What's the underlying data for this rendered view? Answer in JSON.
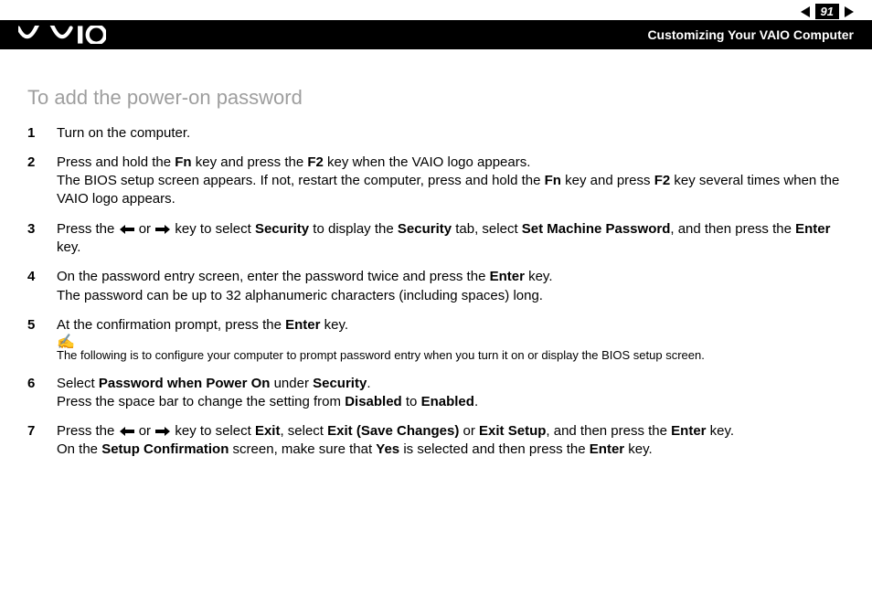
{
  "header": {
    "pageNumber": "91",
    "sectionTitle": "Customizing Your VAIO Computer"
  },
  "heading": "To add the power-on password",
  "steps": {
    "s1": "Turn on the computer.",
    "s2a": "Press and hold the ",
    "s2b": " key and press the ",
    "s2c": " key when the VAIO logo appears.",
    "s2d": "The BIOS setup screen appears. If not, restart the computer, press and hold the ",
    "s2e": " key and press ",
    "s2f": " key several times when the VAIO logo appears.",
    "s3a": "Press the ",
    "s3b": " or ",
    "s3c": " key to select ",
    "s3d": " to display the ",
    "s3e": " tab, select ",
    "s3f": ", and then press the ",
    "s3g": " key.",
    "s4a": "On the password entry screen, enter the password twice and press the ",
    "s4b": " key.",
    "s4c": "The password can be up to 32 alphanumeric characters (including spaces) long.",
    "s5a": "At the confirmation prompt, press the ",
    "s5b": " key.",
    "s6a": "Select ",
    "s6b": " under ",
    "s6c": ".",
    "s6d": "Press the space bar to change the setting from ",
    "s6e": " to ",
    "s6f": ".",
    "s7a": "Press the ",
    "s7b": " or ",
    "s7c": " key to select ",
    "s7d": ", select ",
    "s7e": " or ",
    "s7f": ", and then press the ",
    "s7g": " key.",
    "s7h": "On the ",
    "s7i": " screen, make sure that ",
    "s7j": " is selected and then press the ",
    "s7k": " key."
  },
  "bold": {
    "fn": "Fn",
    "f2": "F2",
    "security": "Security",
    "setMachinePassword": "Set Machine Password",
    "enter": "Enter",
    "passwordWhenPowerOn": "Password when Power On",
    "disabled": "Disabled",
    "enabled": "Enabled",
    "exit": "Exit",
    "exitSaveChanges": "Exit (Save Changes)",
    "exitSetup": "Exit Setup",
    "setupConfirmation": "Setup Confirmation",
    "yes": "Yes"
  },
  "note": "The following is to configure your computer to prompt password entry when you turn it on or display the BIOS setup screen."
}
